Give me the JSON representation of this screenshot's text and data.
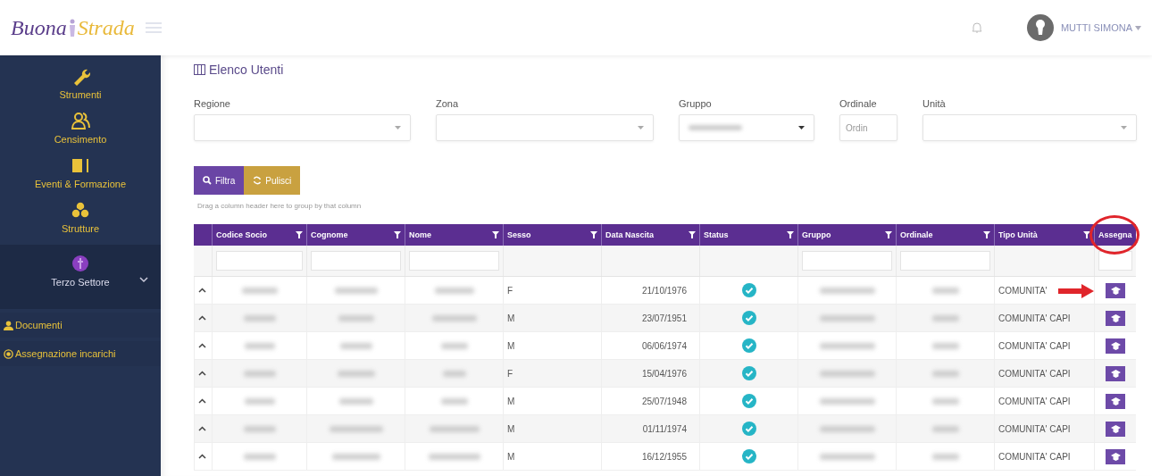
{
  "header": {
    "logo": {
      "part_1": "Buona",
      "part_2": "Strada"
    },
    "user": {
      "name": "MUTTI SIMONA"
    }
  },
  "sidebar": {
    "items": [
      {
        "label": "Strumenti",
        "selected": false
      },
      {
        "label": "Censimento",
        "selected": false
      },
      {
        "label": "Eventi & Formazione",
        "selected": false
      },
      {
        "label": "Strutture",
        "selected": false
      },
      {
        "label": "Terzo Settore",
        "selected": true,
        "expanded": true,
        "children": [
          {
            "label": "Documenti"
          },
          {
            "label": "Assegnazione incarichi"
          }
        ]
      }
    ]
  },
  "page": {
    "title": "Elenco Utenti",
    "filters": [
      {
        "label": "Regione",
        "kind": "select",
        "has_value": false
      },
      {
        "label": "Zona",
        "kind": "select",
        "has_value": false
      },
      {
        "label": "Gruppo",
        "kind": "select",
        "has_value": true
      },
      {
        "label": "Ordinale",
        "kind": "text",
        "placeholder": "Ordin"
      },
      {
        "label": "Unità",
        "kind": "select",
        "has_value": false
      }
    ],
    "buttons": [
      {
        "label": "Filtra",
        "kind": "primary"
      },
      {
        "label": "Pulisci",
        "kind": "secondary"
      }
    ],
    "group_hint": "Drag a column header here to group by that column"
  },
  "table": {
    "columns": [
      {
        "label": "Codice Socio",
        "filter_menu": true,
        "filter_field": true
      },
      {
        "label": "Cognome",
        "filter_menu": true,
        "filter_field": true
      },
      {
        "label": "Nome",
        "filter_menu": true,
        "filter_field": true
      },
      {
        "label": "Sesso",
        "filter_menu": true,
        "filter_field": false
      },
      {
        "label": "Data Nascita",
        "filter_menu": true,
        "filter_field": false
      },
      {
        "label": "Status",
        "filter_menu": true,
        "filter_field": false
      },
      {
        "label": "Gruppo",
        "filter_menu": true,
        "filter_field": true
      },
      {
        "label": "Ordinale",
        "filter_menu": true,
        "filter_field": true
      },
      {
        "label": "Tipo Unità",
        "filter_menu": true,
        "filter_field": false
      },
      {
        "label": "Assegna",
        "filter_menu": false,
        "filter_field": true,
        "highlighted": true
      }
    ],
    "rows": [
      {
        "sesso": "F",
        "data_nascita": "21/10/1976",
        "status_ok": true,
        "tipo_unita": "COMUNITA'",
        "arrow": true
      },
      {
        "sesso": "M",
        "data_nascita": "23/07/1951",
        "status_ok": true,
        "tipo_unita": "COMUNITA' CAPI",
        "arrow": false
      },
      {
        "sesso": "M",
        "data_nascita": "06/06/1974",
        "status_ok": true,
        "tipo_unita": "COMUNITA' CAPI",
        "arrow": false
      },
      {
        "sesso": "F",
        "data_nascita": "15/04/1976",
        "status_ok": true,
        "tipo_unita": "COMUNITA' CAPI",
        "arrow": false
      },
      {
        "sesso": "M",
        "data_nascita": "25/07/1948",
        "status_ok": true,
        "tipo_unita": "COMUNITA' CAPI",
        "arrow": false
      },
      {
        "sesso": "M",
        "data_nascita": "01/11/1974",
        "status_ok": true,
        "tipo_unita": "COMUNITA' CAPI",
        "arrow": false
      },
      {
        "sesso": "M",
        "data_nascita": "16/12/1955",
        "status_ok": true,
        "tipo_unita": "COMUNITA' CAPI",
        "arrow": false
      }
    ]
  }
}
